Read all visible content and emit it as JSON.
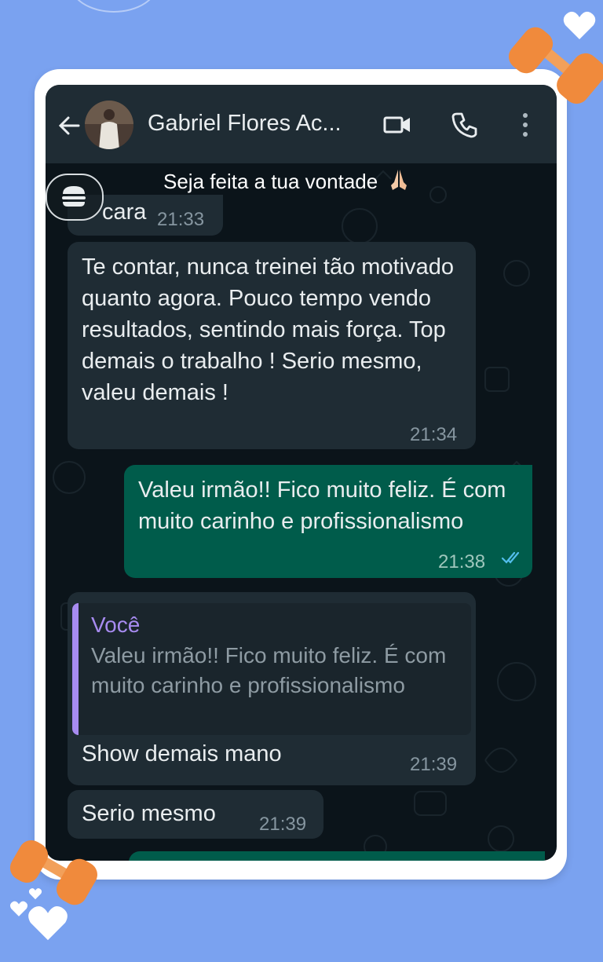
{
  "header": {
    "contact_name": "Gabriel Flores Ac..."
  },
  "pinned_message": {
    "text": "Seja feita a tua vontade",
    "emoji": "folded-hands"
  },
  "messages": [
    {
      "direction": "incoming",
      "text": "cara",
      "time": "21:33"
    },
    {
      "direction": "incoming",
      "text": "Te contar, nunca treinei tão motivado quanto agora. Pouco tempo vendo resultados, sentindo mais força. Top demais o trabalho ! Serio mesmo, valeu demais !",
      "time": "21:34"
    },
    {
      "direction": "outgoing",
      "text": "Valeu irmão!! Fico muito feliz. É com muito carinho e profissionalismo",
      "time": "21:38",
      "status": "read"
    },
    {
      "direction": "incoming",
      "reply_to": {
        "author": "Você",
        "text": "Valeu irmão!! Fico muito feliz. É com muito carinho e profissionalismo"
      },
      "text": "Show demais mano",
      "time": "21:39"
    },
    {
      "direction": "incoming",
      "text": "Serio mesmo",
      "time": "21:39"
    }
  ],
  "colors": {
    "page_background": "#7aa2f0",
    "header": "#1f2c34",
    "chat_background": "#0b141a",
    "incoming_bubble": "#1f2c34",
    "outgoing_bubble": "#005c4b",
    "quote_accent": "#a78bf0",
    "read_ticks": "#53bdeb",
    "dumbbell": "#f08a3c"
  },
  "icons": [
    "back-arrow-icon",
    "video-call-icon",
    "voice-call-icon",
    "more-options-icon",
    "menu-icon",
    "double-check-icon",
    "dumbbell-icon",
    "heart-icon"
  ]
}
